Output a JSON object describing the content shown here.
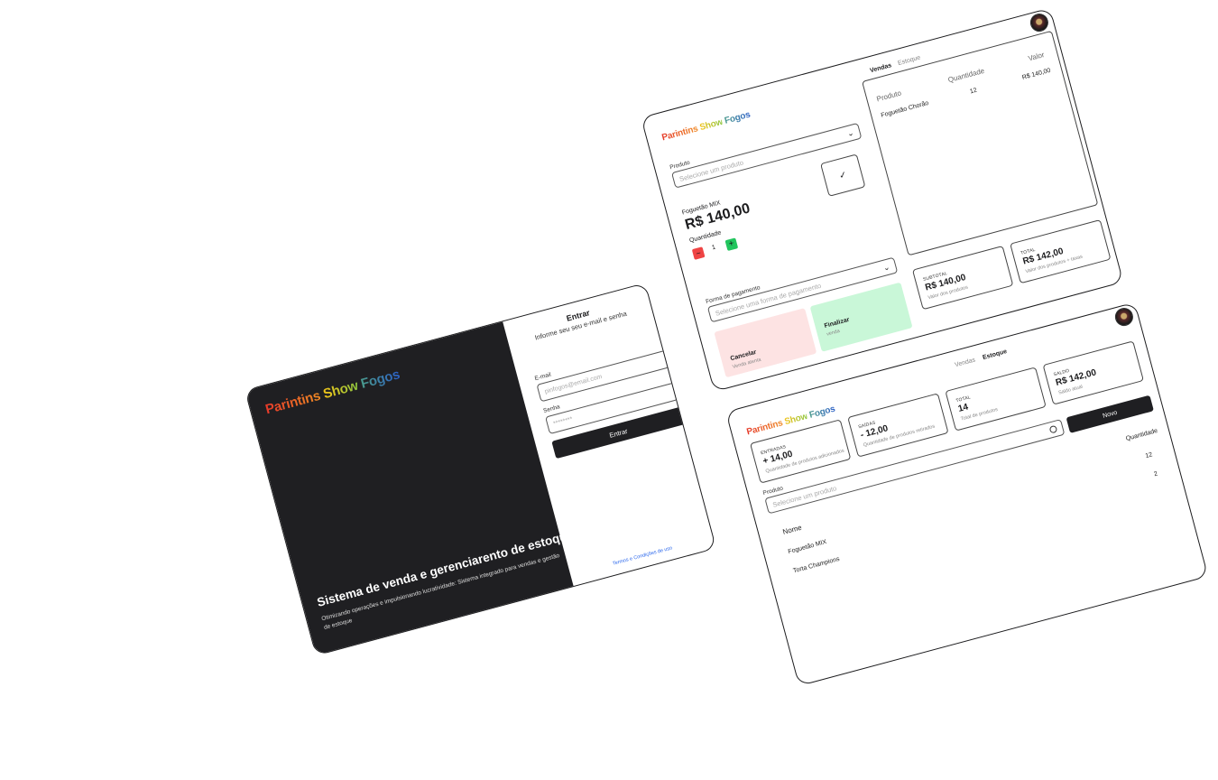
{
  "brand": {
    "word1": "Parintins",
    "word2": "Show",
    "word3": "Fogos"
  },
  "login": {
    "tagline_title": "Sistema de venda e gerenciarento de estoque",
    "tagline_sub": "Otimizando operações e impulsionando lucratividade: Sistema integrado para vendas e gestão de estoque",
    "form_title": "Entrar",
    "form_subtitle": "Informe seu seu e-mail e senha",
    "email_label": "E-mail",
    "email_placeholder": "pinfogos@email.com",
    "password_label": "Senha",
    "password_placeholder": "********",
    "submit_label": "Entrar",
    "terms_link": "Termos e Condições de uso"
  },
  "sales": {
    "nav": {
      "vendas": "Vendas",
      "estoque": "Estoque"
    },
    "product_label": "Produto",
    "product_placeholder": "Selecione um produto",
    "selected_name": "Foguetão MIX",
    "selected_price": "R$ 140,00",
    "qty_label": "Quantidade",
    "qty_minus": "−",
    "qty_value": "1",
    "qty_plus": "+",
    "confirm_icon": "✓",
    "payment_label": "Forma de pagamento",
    "payment_placeholder": "Selecione uma forma de pagamento",
    "cancel_title": "Cancelar",
    "cancel_sub": "Venda atenta",
    "finish_title": "Finalizar",
    "finish_sub": "venda",
    "table": {
      "headers": [
        "Produto",
        "Quantidade",
        "Valor"
      ],
      "rows": [
        {
          "produto": "Foguetão Chorão",
          "quantidade": "12",
          "valor": "R$ 140,00"
        }
      ]
    },
    "subtotal": {
      "label": "SUBTOTAL",
      "value": "R$ 140,00",
      "sub": "Valor dos produtos"
    },
    "total": {
      "label": "TOTAL",
      "value": "R$ 142,00",
      "sub": "Valor dos produtos + taxas"
    }
  },
  "stock": {
    "nav": {
      "vendas": "Vendas",
      "estoque": "Estoque"
    },
    "entradas": {
      "label": "ENTRADAS",
      "value": "+ 14,00",
      "sub": "Quantidade de produtos adicionados"
    },
    "saidas": {
      "label": "SAÍDAS",
      "value": "- 12,00",
      "sub": "Quantidade de produtos retirados"
    },
    "total": {
      "label": "TOTAL",
      "value": "14",
      "sub": "Total de produtos"
    },
    "saldo": {
      "label": "SALDO",
      "value": "R$ 142,00",
      "sub": "Saldo atual"
    },
    "new_button": "Novo",
    "product_label": "Produto",
    "product_placeholder": "Selecione um produto",
    "table": {
      "headers": [
        "Nome",
        "Quantidade"
      ],
      "rows": [
        {
          "nome": "Foguetão MIX",
          "quantidade": "12"
        },
        {
          "nome": "Torta Champions",
          "quantidade": "2"
        }
      ]
    }
  },
  "colors": {
    "dark_panel": "#1f1f22",
    "cancel_bg": "#fde3e3",
    "finish_bg": "#c9f7d8",
    "minus": "#ef4444",
    "plus": "#22c55e",
    "link": "#2563eb"
  }
}
